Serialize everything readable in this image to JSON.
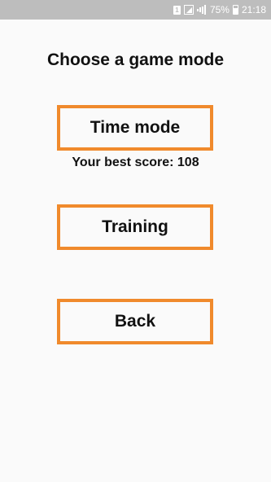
{
  "status_bar": {
    "sim_label": "1",
    "battery_percent": "75%",
    "time": "21:18"
  },
  "screen": {
    "title": "Choose a game mode",
    "time_mode_label": "Time mode",
    "best_score_text": "Your best score: 108",
    "training_label": "Training",
    "back_label": "Back"
  },
  "colors": {
    "accent": "#f08a2c",
    "background": "#fafafa",
    "status_bar": "#bdbdbd"
  }
}
